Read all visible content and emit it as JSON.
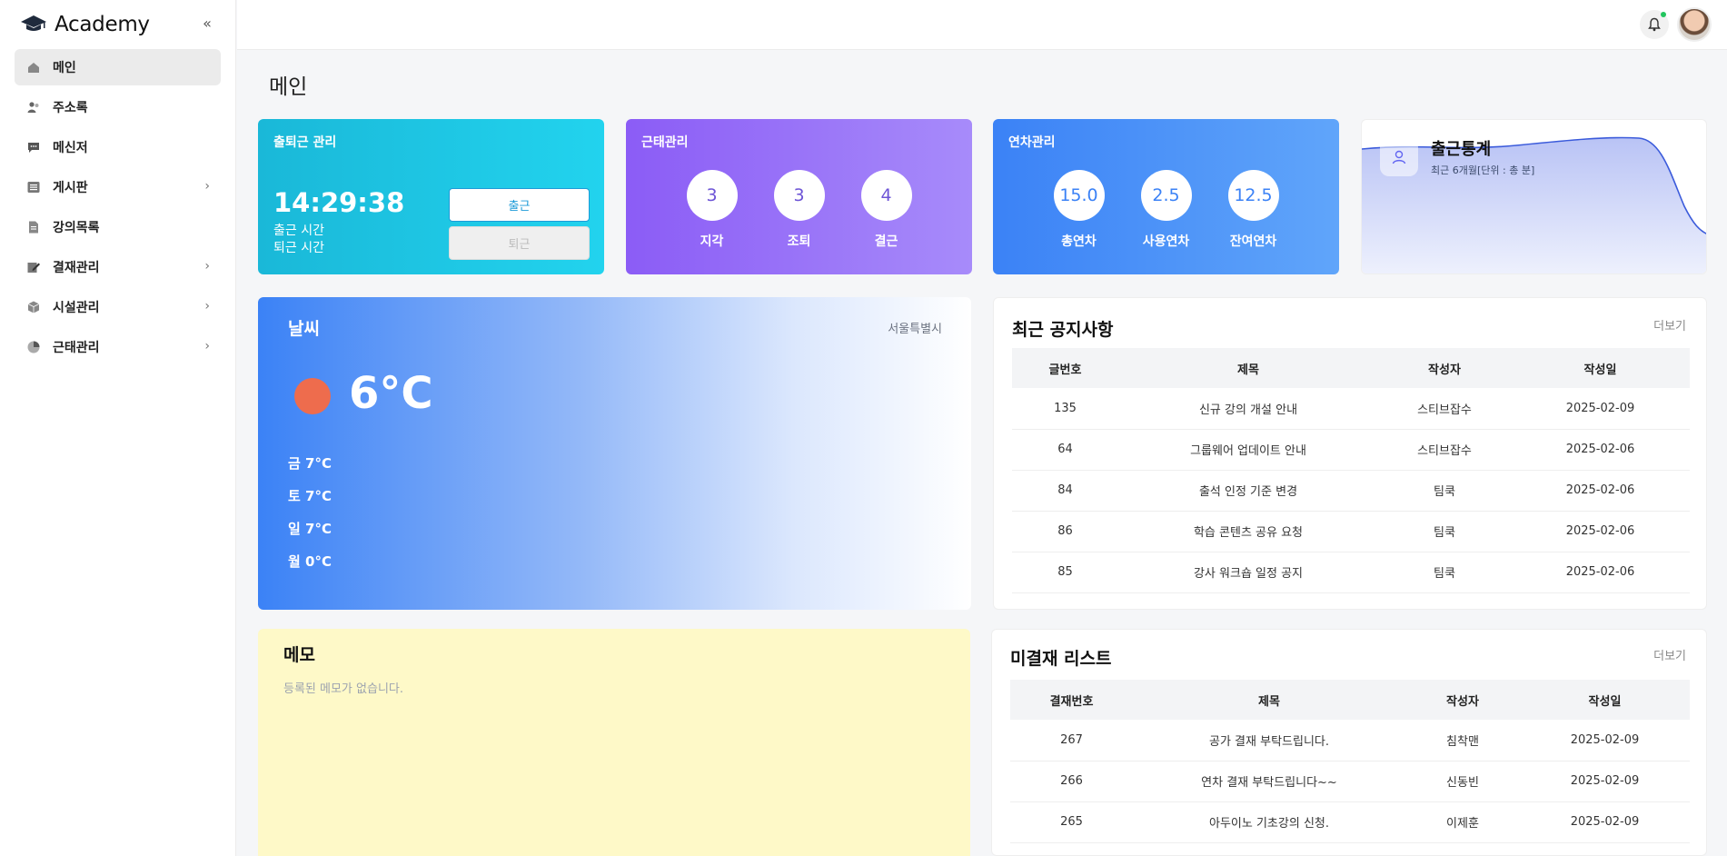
{
  "app": {
    "name": "Academy",
    "logo_caption": "ACADEMY"
  },
  "sidebar": {
    "items": [
      {
        "label": "메인",
        "icon": "home-icon",
        "active": true,
        "has_children": false
      },
      {
        "label": "주소록",
        "icon": "users-icon",
        "active": false,
        "has_children": false
      },
      {
        "label": "메신저",
        "icon": "chat-icon",
        "active": false,
        "has_children": false
      },
      {
        "label": "게시판",
        "icon": "list-icon",
        "active": false,
        "has_children": true
      },
      {
        "label": "강의목록",
        "icon": "document-icon",
        "active": false,
        "has_children": false
      },
      {
        "label": "결재관리",
        "icon": "edit-icon",
        "active": false,
        "has_children": true
      },
      {
        "label": "시설관리",
        "icon": "cube-icon",
        "active": false,
        "has_children": true
      },
      {
        "label": "근태관리",
        "icon": "pie-chart-icon",
        "active": false,
        "has_children": true
      }
    ]
  },
  "page": {
    "title": "메인"
  },
  "attendance": {
    "title": "출퇴근 관리",
    "clock": "14:29:38",
    "check_in_label": "출근 시간",
    "check_out_label": "퇴근 시간",
    "check_in_button": "출근",
    "check_out_button": "퇴근"
  },
  "work_status": {
    "title": "근태관리",
    "items": [
      {
        "value": "3",
        "label": "지각"
      },
      {
        "value": "3",
        "label": "조퇴"
      },
      {
        "value": "4",
        "label": "결근"
      }
    ]
  },
  "leave_status": {
    "title": "연차관리",
    "items": [
      {
        "value": "15.0",
        "label": "총연차"
      },
      {
        "value": "2.5",
        "label": "사용연차"
      },
      {
        "value": "12.5",
        "label": "잔여연차"
      }
    ]
  },
  "attendance_stats": {
    "title": "출근통계",
    "subtitle": "최근 6개월[단위 : 총 분]",
    "colors": {
      "line": "#3b5bdb",
      "fill": "#c7cff7"
    }
  },
  "weather": {
    "title": "날씨",
    "location": "서울특별시",
    "temperature": "6°C",
    "forecast": [
      "금 7°C",
      "토 7°C",
      "일 7°C",
      "월 0°C"
    ]
  },
  "notices": {
    "title": "최근 공지사항",
    "more": "더보기",
    "columns": [
      "글번호",
      "제목",
      "작성자",
      "작성일"
    ],
    "rows": [
      [
        "135",
        "신규 강의 개설 안내",
        "스티브잡수",
        "2025-02-09"
      ],
      [
        "64",
        "그룹웨어 업데이트 안내",
        "스티브잡수",
        "2025-02-06"
      ],
      [
        "84",
        "출석 인정 기준 변경",
        "팀쿡",
        "2025-02-06"
      ],
      [
        "86",
        "학습 콘텐츠 공유 요청",
        "팀쿡",
        "2025-02-06"
      ],
      [
        "85",
        "강사 워크숍 일정 공지",
        "팀쿡",
        "2025-02-06"
      ]
    ]
  },
  "memo": {
    "title": "메모",
    "empty_text": "등록된 메모가 없습니다."
  },
  "approvals": {
    "title": "미결재 리스트",
    "more": "더보기",
    "columns": [
      "결재번호",
      "제목",
      "작성자",
      "작성일"
    ],
    "rows": [
      [
        "267",
        "공가 결재 부탁드립니다.",
        "침착맨",
        "2025-02-09"
      ],
      [
        "266",
        "연차 결재 부탁드립니다~~",
        "신동빈",
        "2025-02-09"
      ],
      [
        "265",
        "아두이노 기초강의 신청.",
        "이제훈",
        "2025-02-09"
      ]
    ]
  }
}
